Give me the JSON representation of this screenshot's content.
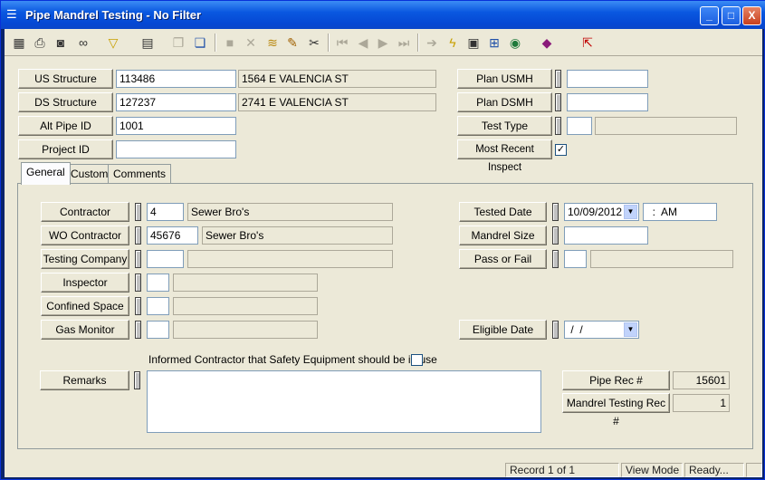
{
  "window": {
    "title": "Pipe Mandrel Testing - No Filter",
    "min": "_",
    "max": "□",
    "close": "X"
  },
  "toolbar": {
    "icons": [
      "grid-icon",
      "print-icon",
      "print-preview-icon",
      "binoculars-icon",
      "filter-icon",
      "report-icon",
      "copy-icon",
      "copy2-icon",
      "save-icon",
      "delete-icon",
      "stack-icon",
      "pencil-icon",
      "scissors-icon",
      "first-icon",
      "prev-icon",
      "next-icon",
      "last-icon",
      "goto-icon",
      "lightning-icon",
      "doc-icon",
      "tree-icon",
      "globe-icon",
      "book-icon",
      "exit-icon"
    ]
  },
  "header": {
    "us_structure_btn": "US Structure",
    "us_structure_id": "113486",
    "us_structure_addr": "1564  E  VALENCIA ST",
    "ds_structure_btn": "DS Structure",
    "ds_structure_id": "127237",
    "ds_structure_addr": "2741  E VALENCIA ST",
    "alt_pipe_btn": "Alt Pipe ID",
    "alt_pipe_id": "1001",
    "project_btn": "Project ID",
    "project_id": "",
    "plan_usmh_btn": "Plan USMH",
    "plan_usmh": "",
    "plan_dsmh_btn": "Plan DSMH",
    "plan_dsmh": "",
    "test_type_btn": "Test Type",
    "test_type": "",
    "most_recent_btn": "Most Recent Inspect",
    "most_recent_checked": "✓"
  },
  "tabs": [
    "General",
    "Custom",
    "Comments"
  ],
  "general": {
    "contractor_btn": "Contractor",
    "contractor_id": "4",
    "contractor_name": "Sewer Bro's",
    "wo_contractor_btn": "WO Contractor",
    "wo_contractor_id": "45676",
    "wo_contractor_name": "Sewer Bro's",
    "testing_company_btn": "Testing Company",
    "inspector_btn": "Inspector",
    "confined_space_btn": "Confined Space",
    "gas_monitor_btn": "Gas Monitor",
    "tested_date_btn": "Tested Date",
    "tested_date": "10/09/2012",
    "tested_time": "  :  AM",
    "mandrel_size_btn": "Mandrel Size",
    "mandrel_size": "",
    "pass_fail_btn": "Pass or Fail",
    "eligible_date_btn": "Eligible Date",
    "eligible_date": " /  /",
    "informed_label": "Informed Contractor that Safety Equipment should be in use",
    "remarks_btn": "Remarks",
    "remarks": "",
    "pipe_rec_btn": "Pipe Rec #",
    "pipe_rec": "15601",
    "mandrel_rec_btn": "Mandrel Testing Rec #",
    "mandrel_rec": "1"
  },
  "status": {
    "record": "Record 1 of 1",
    "mode": "View Mode",
    "state": "Ready..."
  }
}
